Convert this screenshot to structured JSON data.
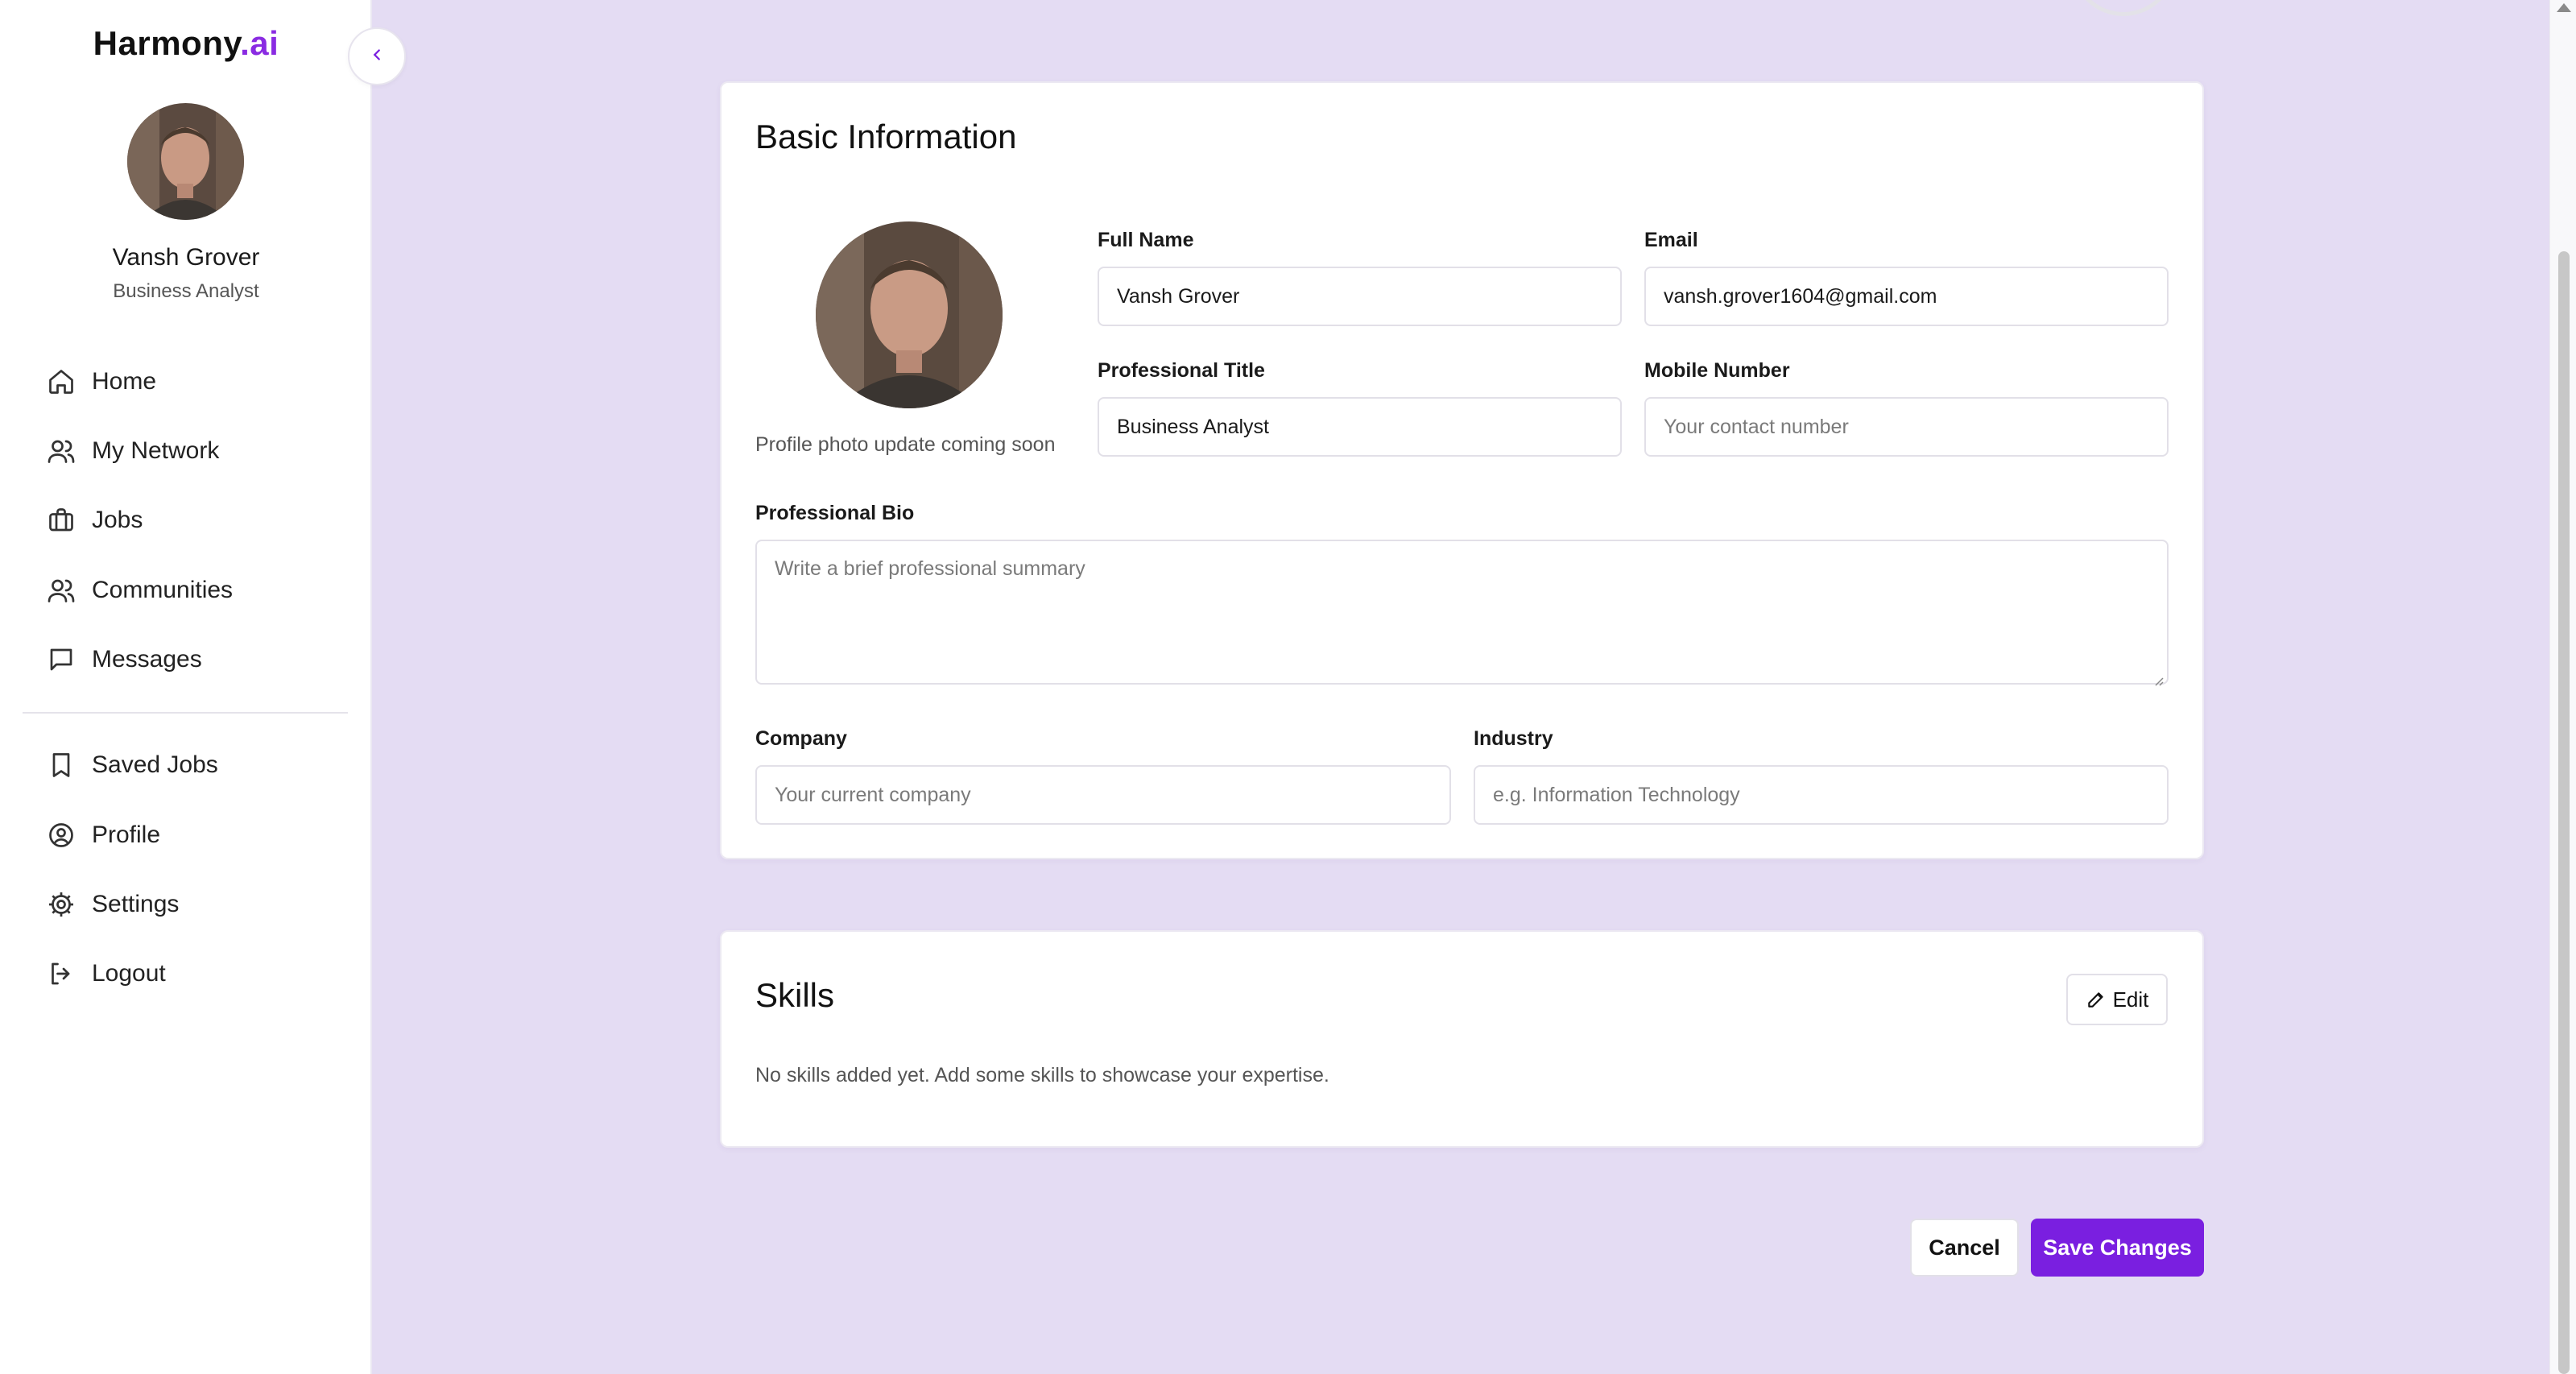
{
  "brand": {
    "name": "Harmony",
    "suffix": ".ai"
  },
  "sidebar": {
    "user_name": "Vansh Grover",
    "user_role": "Business Analyst",
    "items": [
      {
        "label": "Home",
        "icon": "home-icon"
      },
      {
        "label": "My Network",
        "icon": "users-icon"
      },
      {
        "label": "Jobs",
        "icon": "briefcase-icon"
      },
      {
        "label": "Communities",
        "icon": "users-icon"
      },
      {
        "label": "Messages",
        "icon": "message-icon"
      }
    ],
    "items2": [
      {
        "label": "Saved Jobs",
        "icon": "bookmark-icon"
      },
      {
        "label": "Profile",
        "icon": "user-circle-icon"
      },
      {
        "label": "Settings",
        "icon": "gear-icon"
      },
      {
        "label": "Logout",
        "icon": "logout-icon"
      }
    ]
  },
  "basic": {
    "title": "Basic Information",
    "photo_note": "Profile photo update coming soon",
    "full_name_label": "Full Name",
    "full_name_value": "Vansh Grover",
    "email_label": "Email",
    "email_value": "vansh.grover1604@gmail.com",
    "title_label": "Professional Title",
    "title_value": "Business Analyst",
    "mobile_label": "Mobile Number",
    "mobile_placeholder": "Your contact number",
    "bio_label": "Professional Bio",
    "bio_placeholder": "Write a brief professional summary",
    "company_label": "Company",
    "company_placeholder": "Your current company",
    "industry_label": "Industry",
    "industry_placeholder": "e.g. Information Technology"
  },
  "skills": {
    "title": "Skills",
    "edit_label": "Edit",
    "empty_text": "No skills added yet. Add some skills to showcase your expertise."
  },
  "actions": {
    "cancel_label": "Cancel",
    "save_label": "Save Changes"
  },
  "colors": {
    "accent": "#7a1fe0",
    "brand_accent": "#8a2be2",
    "background": "#f6f4fc"
  }
}
